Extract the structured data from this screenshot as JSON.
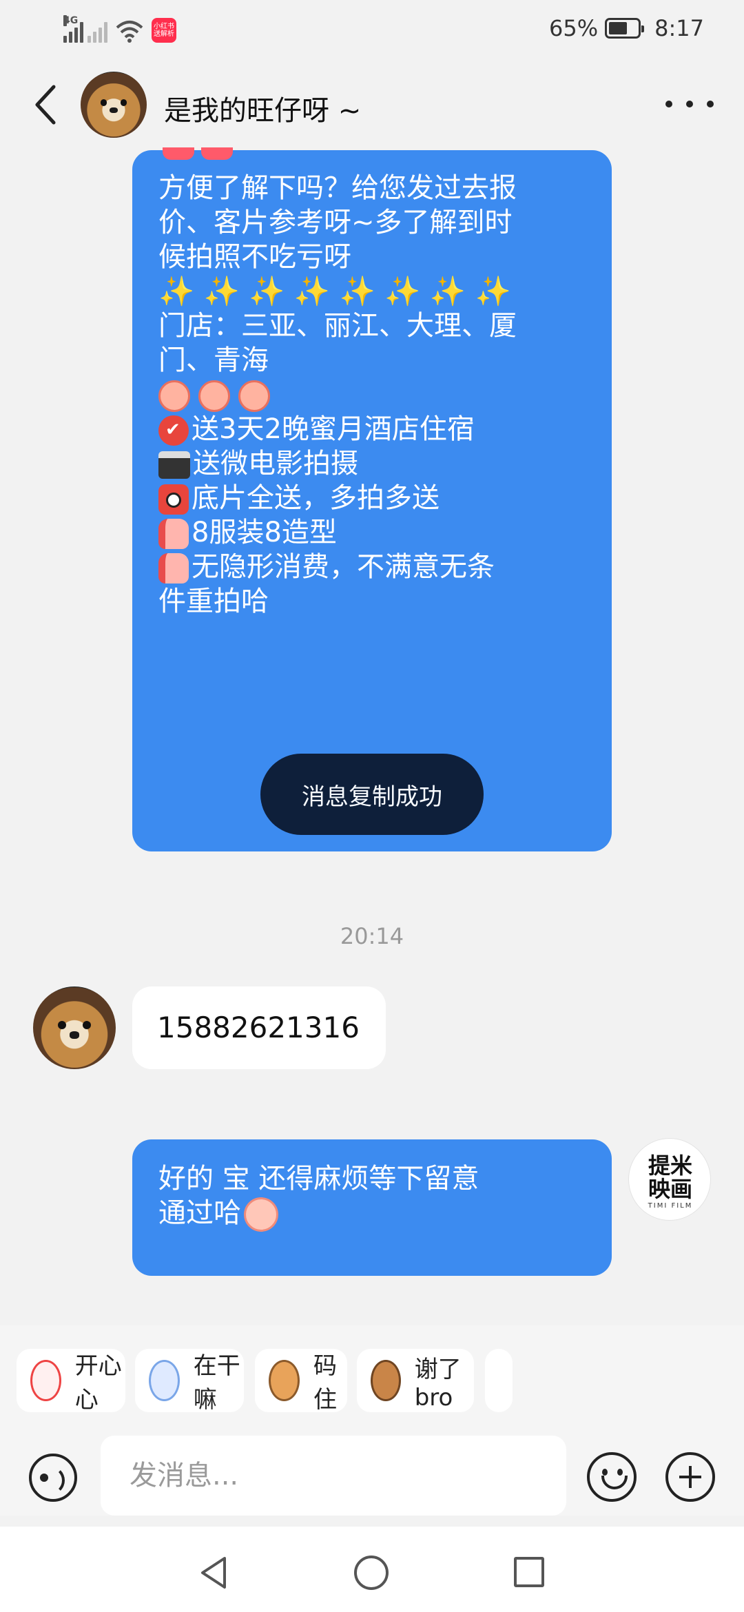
{
  "status_bar": {
    "network_tag": "4G",
    "app_badge_line1": "小红书",
    "app_badge_line2": "送解析",
    "battery_text": "65%",
    "battery_level": 0.65,
    "time": "8:17"
  },
  "header": {
    "back_icon": "chevron-left-icon",
    "title": "是我的旺仔呀 ~",
    "more_icon": "more-dots-icon"
  },
  "messages": {
    "msg1": {
      "line1": "方便了解下吗？给您发过去报",
      "line2": "价、客片参考呀~多了解到时",
      "line3": "候拍照不吃亏呀",
      "sparkles": "✨ ✨ ✨ ✨ ✨ ✨ ✨ ✨",
      "line4": "门店：三亚、丽江、大理、厦",
      "line5": "门、青海",
      "line6": "送3天2晚蜜月酒店住宿",
      "line7": "送微电影拍摄",
      "line8": "底片全送，多拍多送",
      "line9": "8服装8造型",
      "line10": "无隐形消费，不满意无条",
      "line11": "件重拍哈"
    },
    "toast": "消息复制成功",
    "timestamp": "20:14",
    "msg2": "15882621316",
    "msg3": {
      "line1": "好的  宝  还得麻烦等下留意",
      "line2": "通过哈"
    }
  },
  "self_avatar": {
    "brand_line1": "提米",
    "brand_line2": "映画",
    "brand_sub": "TIMI FILM"
  },
  "quick_replies": [
    "开心心",
    "在干嘛",
    "码住",
    "谢了bro"
  ],
  "input": {
    "placeholder": "发消息..."
  },
  "colors": {
    "outgoing_bubble": "#3c8bf0",
    "incoming_bubble": "#ffffff",
    "background": "#f2f2f2",
    "toast": "#0d1b33"
  }
}
